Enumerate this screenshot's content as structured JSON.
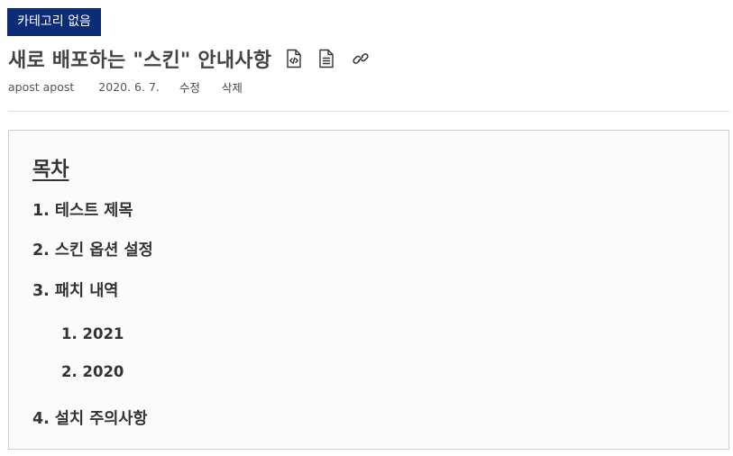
{
  "category": {
    "label": "카테고리 없음"
  },
  "post": {
    "title": "새로 배포하는 \"스킨\" 안내사항",
    "icons": [
      "code-file-icon",
      "document-icon",
      "link-icon"
    ]
  },
  "meta": {
    "author": "apost apost",
    "date": "2020. 6. 7.",
    "edit_label": "수정",
    "delete_label": "삭제"
  },
  "toc": {
    "title": "목차",
    "items": [
      {
        "label": "1. 테스트 제목",
        "level": 1
      },
      {
        "label": "2. 스킨 옵션 설정",
        "level": 1
      },
      {
        "label": "3. 패치 내역",
        "level": 1
      },
      {
        "label": "1. 2021",
        "level": 2
      },
      {
        "label": "2. 2020",
        "level": 2
      },
      {
        "label": "4. 설치 주의사항",
        "level": 1
      }
    ]
  },
  "colors": {
    "badge_background": "#0d2c78",
    "badge_text": "#ffffff",
    "toc_background": "#fbfbfb",
    "toc_border": "#cfcfcf"
  }
}
